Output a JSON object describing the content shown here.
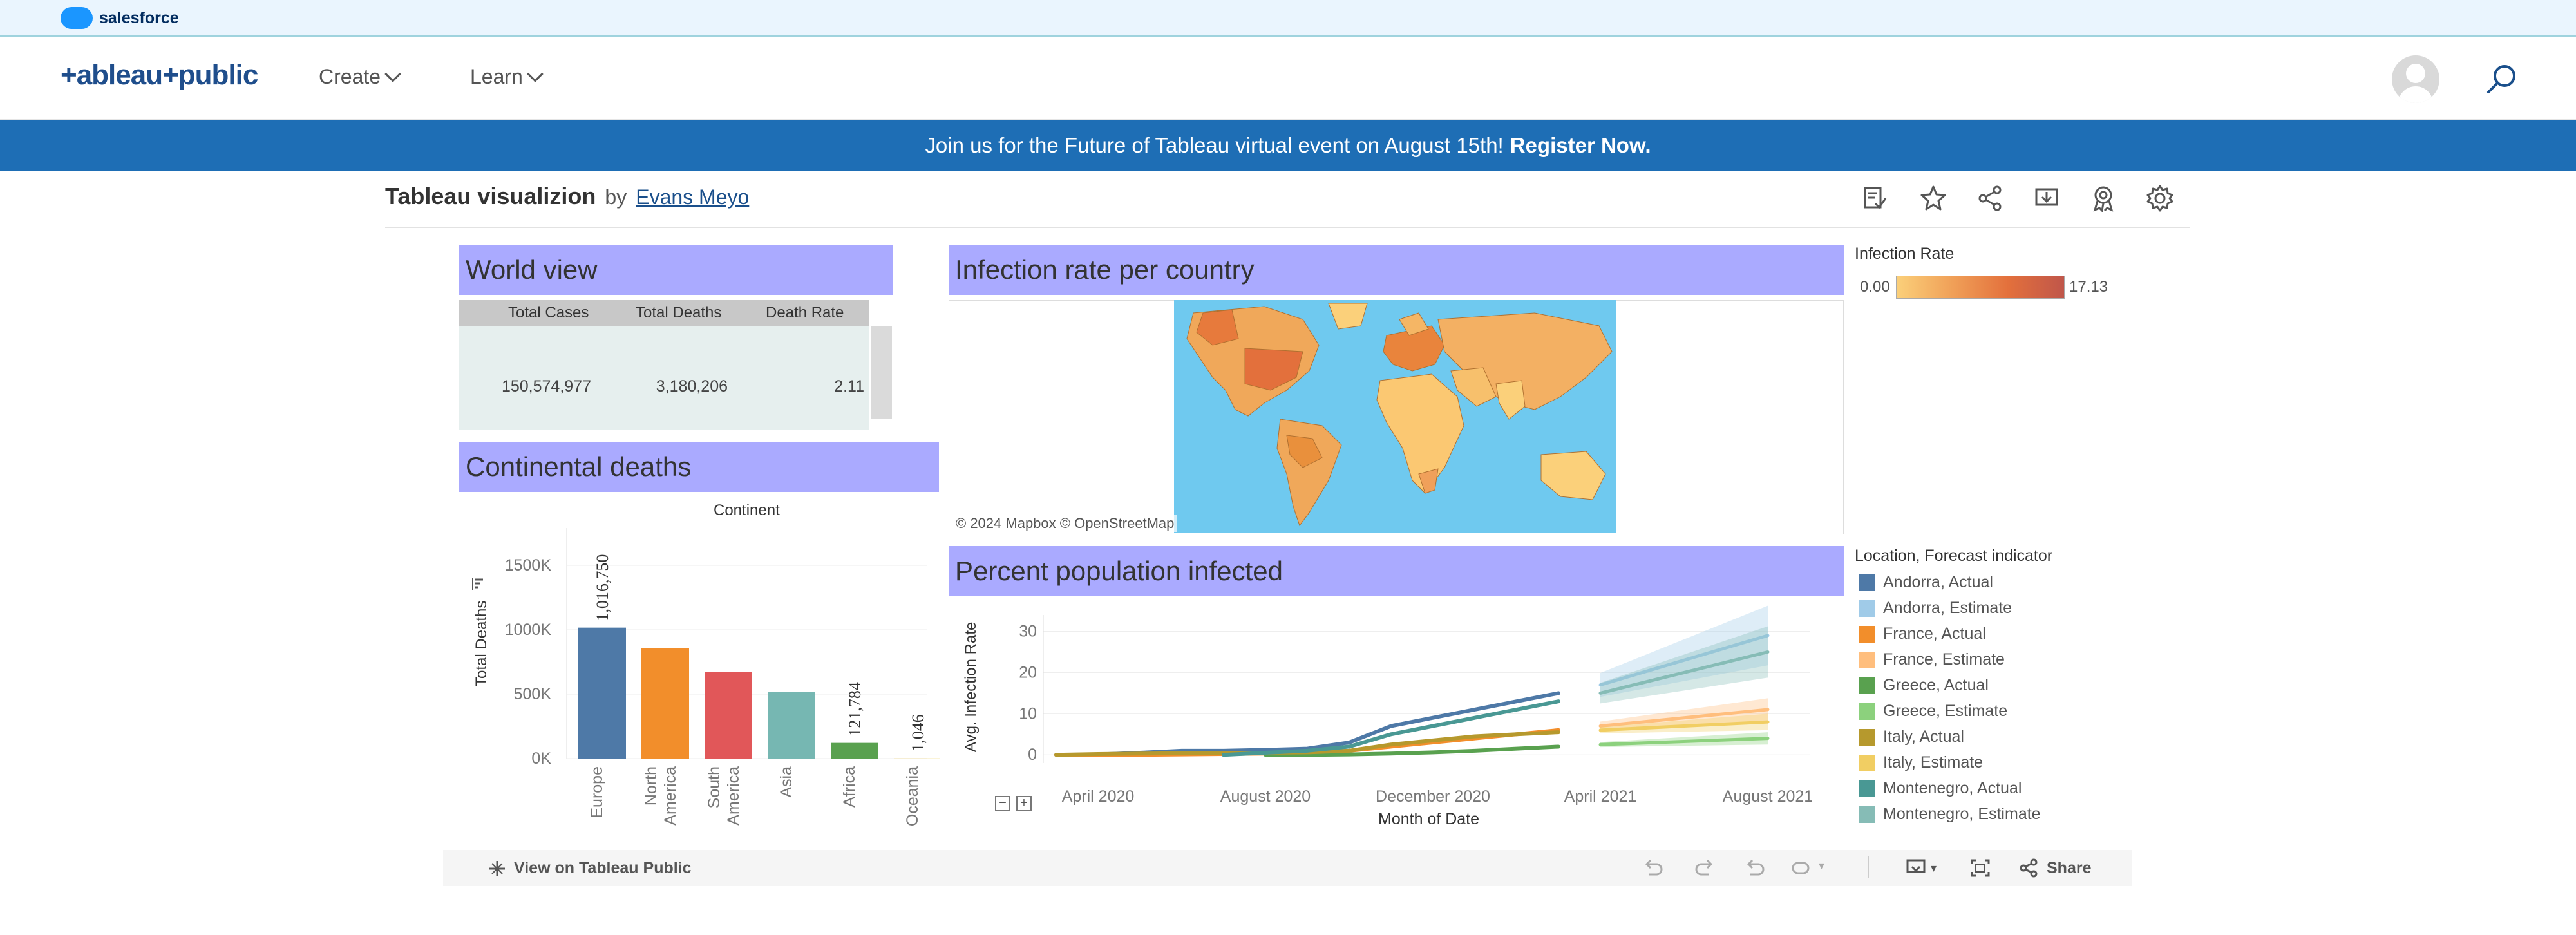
{
  "sf_bar": {
    "brand": "salesforce"
  },
  "header": {
    "logo": "+ableau+public",
    "nav": [
      {
        "label": "Create"
      },
      {
        "label": "Learn"
      }
    ]
  },
  "banner": {
    "text": "Join us for the Future of Tableau virtual event on August 15th!",
    "link": "Register Now."
  },
  "viz": {
    "title": "Tableau visualizion",
    "by": "by",
    "author": "Evans Meyo"
  },
  "world_view": {
    "title": "World view",
    "columns": [
      "Total Cases",
      "Total Deaths",
      "Death Rate"
    ],
    "values": [
      "150,574,977",
      "3,180,206",
      "2.11"
    ]
  },
  "continental": {
    "title": "Continental deaths",
    "subtitle": "Continent",
    "ylabel": "Total Deaths",
    "yticks": [
      "1500K",
      "1000K",
      "500K",
      "0K"
    ]
  },
  "infection_map": {
    "title": "Infection rate per country",
    "credit": "© 2024 Mapbox  © OpenStreetMap",
    "legend_title": "Infection Rate",
    "legend_min": "0.00",
    "legend_max": "17.13"
  },
  "percent_infected": {
    "title": "Percent population infected",
    "ylabel": "Avg. Infection Rate",
    "xlabel": "Month of Date",
    "legend_title": "Location, Forecast indicator"
  },
  "bottom_bar": {
    "view_label": "View on Tableau Public",
    "share_label": "Share"
  },
  "colors": {
    "header_band": "#aaaaff",
    "banner": "#1e6eb5",
    "accent": "#1a4f8b"
  },
  "chart_data": [
    {
      "type": "bar",
      "title": "Continental deaths",
      "xlabel": "Continent",
      "ylabel": "Total Deaths",
      "ylim": [
        0,
        1700000
      ],
      "categories": [
        "Europe",
        "North America",
        "South America",
        "Asia",
        "Africa",
        "Oceania"
      ],
      "category_lines": [
        [
          "Europe"
        ],
        [
          "North",
          "America"
        ],
        [
          "South",
          "America"
        ],
        [
          "Asia"
        ],
        [
          "Africa"
        ],
        [
          "Oceania"
        ]
      ],
      "values": [
        1016750,
        860000,
        670000,
        520000,
        121784,
        1046
      ],
      "colors": [
        "#4e79a7",
        "#f28e2b",
        "#e15759",
        "#76b7b2",
        "#59a14f",
        "#edc948"
      ],
      "data_labels": [
        "1,016,750",
        "",
        "",
        "",
        "121,784",
        "1,046"
      ]
    },
    {
      "type": "line",
      "title": "Percent population infected",
      "xlabel": "Month of Date",
      "ylabel": "Avg. Infection Rate",
      "ylim": [
        -2,
        34
      ],
      "yticks": [
        0,
        10,
        20,
        30
      ],
      "x_ticks": [
        "April 2020",
        "August 2020",
        "December 2020",
        "April 2021",
        "August 2021"
      ],
      "x_tick_index": [
        1,
        5,
        9,
        13,
        17
      ],
      "series": [
        {
          "name": "Andorra, Actual",
          "color": "#4e79a7",
          "x": [
            0,
            1,
            2,
            3,
            4,
            5,
            6,
            7,
            8,
            9,
            10,
            11,
            12
          ],
          "values": [
            0,
            0.1,
            0.5,
            1,
            1,
            1.2,
            1.5,
            3,
            7,
            9,
            11,
            13,
            15
          ]
        },
        {
          "name": "Andorra, Estimate",
          "color": "#a0cbe8",
          "x": [
            13,
            17
          ],
          "values": [
            17,
            29
          ]
        },
        {
          "name": "France, Actual",
          "color": "#f28e2b",
          "x": [
            0,
            1,
            2,
            3,
            4,
            5,
            6,
            7,
            8,
            9,
            10,
            11,
            12
          ],
          "values": [
            0,
            0,
            0,
            0.1,
            0.2,
            0.3,
            0.5,
            1,
            2,
            3,
            4,
            5,
            6
          ]
        },
        {
          "name": "France, Estimate",
          "color": "#ffbe7d",
          "x": [
            13,
            17
          ],
          "values": [
            7,
            11
          ]
        },
        {
          "name": "Greece, Actual",
          "color": "#59a14f",
          "x": [
            5,
            6,
            7,
            8,
            9,
            10,
            11,
            12
          ],
          "values": [
            0,
            0,
            0.1,
            0.3,
            0.6,
            1,
            1.5,
            2
          ]
        },
        {
          "name": "Greece, Estimate",
          "color": "#8cd17d",
          "x": [
            13,
            17
          ],
          "values": [
            2.5,
            4
          ]
        },
        {
          "name": "Italy, Actual",
          "color": "#b6992d",
          "x": [
            0,
            1,
            2,
            3,
            4,
            5,
            6,
            7,
            8,
            9,
            10,
            11,
            12
          ],
          "values": [
            0,
            0.2,
            0.3,
            0.4,
            0.5,
            0.5,
            0.6,
            1,
            2.5,
            3.5,
            4.5,
            5,
            5.5
          ]
        },
        {
          "name": "Italy, Estimate",
          "color": "#f1ce63",
          "x": [
            13,
            17
          ],
          "values": [
            6,
            8
          ]
        },
        {
          "name": "Montenegro, Actual",
          "color": "#499894",
          "x": [
            4,
            5,
            6,
            7,
            8,
            9,
            10,
            11,
            12
          ],
          "values": [
            0,
            0.5,
            1,
            2,
            5,
            7,
            9,
            11,
            13
          ]
        },
        {
          "name": "Montenegro, Estimate",
          "color": "#86bcb6",
          "x": [
            13,
            17
          ],
          "values": [
            15,
            25
          ]
        }
      ]
    }
  ]
}
